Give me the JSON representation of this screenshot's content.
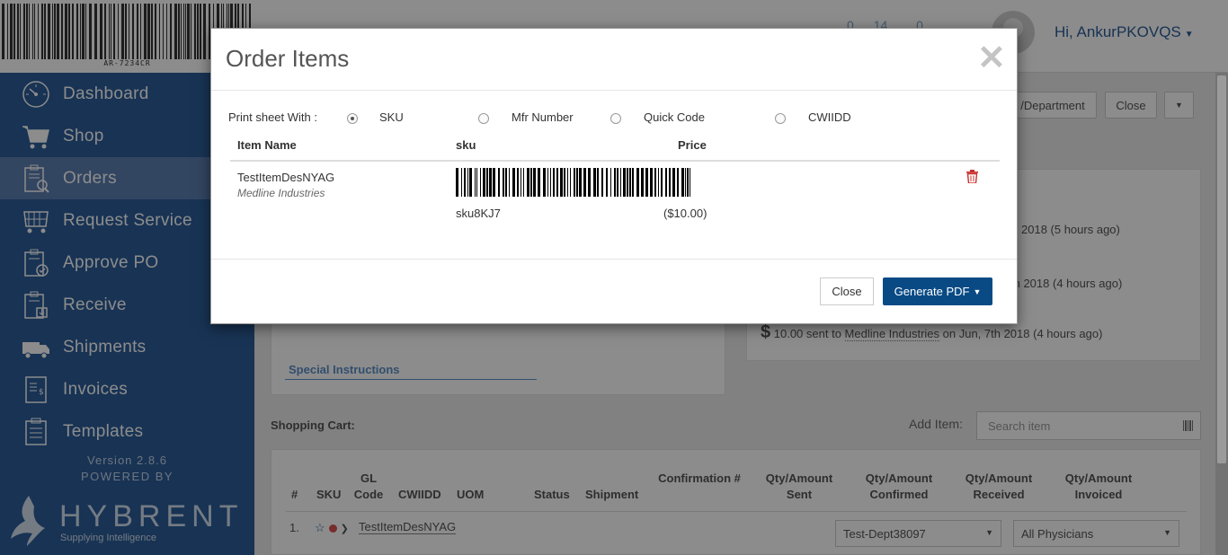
{
  "sidebar": {
    "logo_code": "AR-7234CR",
    "items": [
      {
        "label": "Dashboard",
        "icon": "dashboard-icon",
        "active": false
      },
      {
        "label": "Shop",
        "icon": "cart-icon",
        "active": false
      },
      {
        "label": "Orders",
        "icon": "orders-icon",
        "active": true
      },
      {
        "label": "Request Service",
        "icon": "request-service-icon",
        "active": false
      },
      {
        "label": "Approve PO",
        "icon": "approve-po-icon",
        "active": false
      },
      {
        "label": "Receive",
        "icon": "receive-icon",
        "active": false
      },
      {
        "label": "Shipments",
        "icon": "truck-icon",
        "active": false
      },
      {
        "label": "Invoices",
        "icon": "invoice-icon",
        "active": false
      },
      {
        "label": "Templates",
        "icon": "templates-icon",
        "active": false
      }
    ],
    "version": "Version 2.8.6",
    "powered_by": "POWERED BY",
    "brand": "HYBRENT",
    "tagline": "Supplying Intelligence"
  },
  "topbar": {
    "stat_1": "0",
    "stat_2": "14",
    "stat_3": "0",
    "greeting": "Hi, AnkurPKOVQS"
  },
  "page": {
    "dept_button": "/Department",
    "close_button": "Close",
    "activity": [
      {
        "text": "2018 (5 hours ago)"
      },
      {
        "text": "th 2018 (4 hours ago)"
      },
      {
        "prefix": "10.00 sent to ",
        "link": "Medline Industries",
        "suffix": " on Jun, 7th 2018 (4 hours ago)"
      }
    ],
    "special_instructions": "Special Instructions",
    "cart_title": "Shopping Cart:",
    "add_item_label": "Add Item:",
    "search_placeholder": "Search item",
    "columns": [
      "#",
      "SKU",
      "GL Code",
      "CWIIDD",
      "UOM",
      "Status",
      "Shipment",
      "Confirmation #",
      "Qty/Amount Sent",
      "Qty/Amount Confirmed",
      "Qty/Amount Received",
      "Qty/Amount Invoiced"
    ],
    "row": {
      "num": "1.",
      "item": "TestItemDesNYAG",
      "dept": "Test-Dept38097",
      "physician": "All Physicians"
    }
  },
  "modal": {
    "title": "Order Items",
    "print_label": "Print sheet With :",
    "options": [
      {
        "label": "SKU",
        "checked": true
      },
      {
        "label": "Mfr Number",
        "checked": false
      },
      {
        "label": "Quick Code",
        "checked": false
      },
      {
        "label": "CWIIDD",
        "checked": false
      }
    ],
    "columns": {
      "item_name": "Item Name",
      "sku": "sku",
      "price": "Price"
    },
    "item": {
      "name": "TestItemDesNYAG",
      "vendor": "Medline Industries",
      "sku": "sku8KJ7",
      "price": "($10.00)"
    },
    "close_label": "Close",
    "generate_label": "Generate PDF"
  },
  "colors": {
    "sidebar": "#2c5d9a",
    "sidebar_active": "#5b7fb1",
    "primary_button": "#094a85",
    "delete": "#c9302c"
  }
}
